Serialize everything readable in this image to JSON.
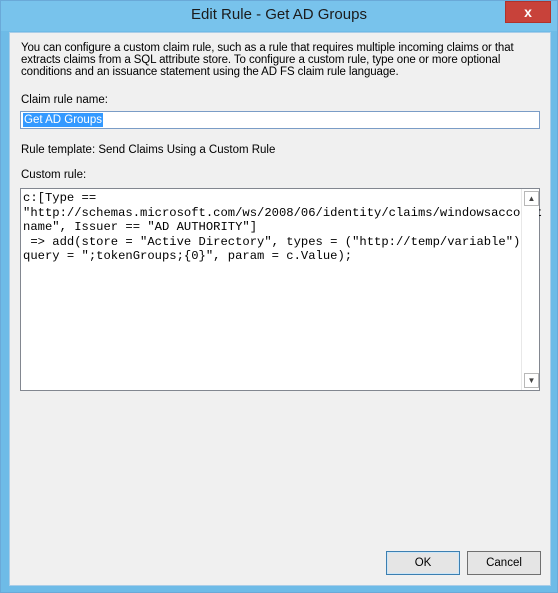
{
  "window": {
    "title": "Edit Rule - Get AD Groups",
    "close_label": "x"
  },
  "dialog": {
    "description": "You can configure a custom claim rule, such as a rule that requires multiple incoming claims or that extracts claims from a SQL attribute store. To configure a custom rule, type one or more optional conditions and an issuance statement using the AD FS claim rule language.",
    "claim_rule_name_label": "Claim rule name:",
    "claim_rule_name_value": "Get AD Groups",
    "rule_template_label": "Rule template: Send Claims Using a Custom Rule",
    "custom_rule_label": "Custom rule:",
    "custom_rule_text": "c:[Type ==\n\"http://schemas.microsoft.com/ws/2008/06/identity/claims/windowsaccount\nname\", Issuer == \"AD AUTHORITY\"]\n => add(store = \"Active Directory\", types = (\"http://temp/variable\"),\nquery = \";tokenGroups;{0}\", param = c.Value);"
  },
  "buttons": {
    "ok": "OK",
    "cancel": "Cancel"
  },
  "icons": {
    "scroll_up": "scroll-up-arrow",
    "scroll_down": "scroll-down-arrow"
  },
  "colors": {
    "titlebar": "#78c3ec",
    "close_button": "#c8423a",
    "selection": "#3399ff"
  }
}
